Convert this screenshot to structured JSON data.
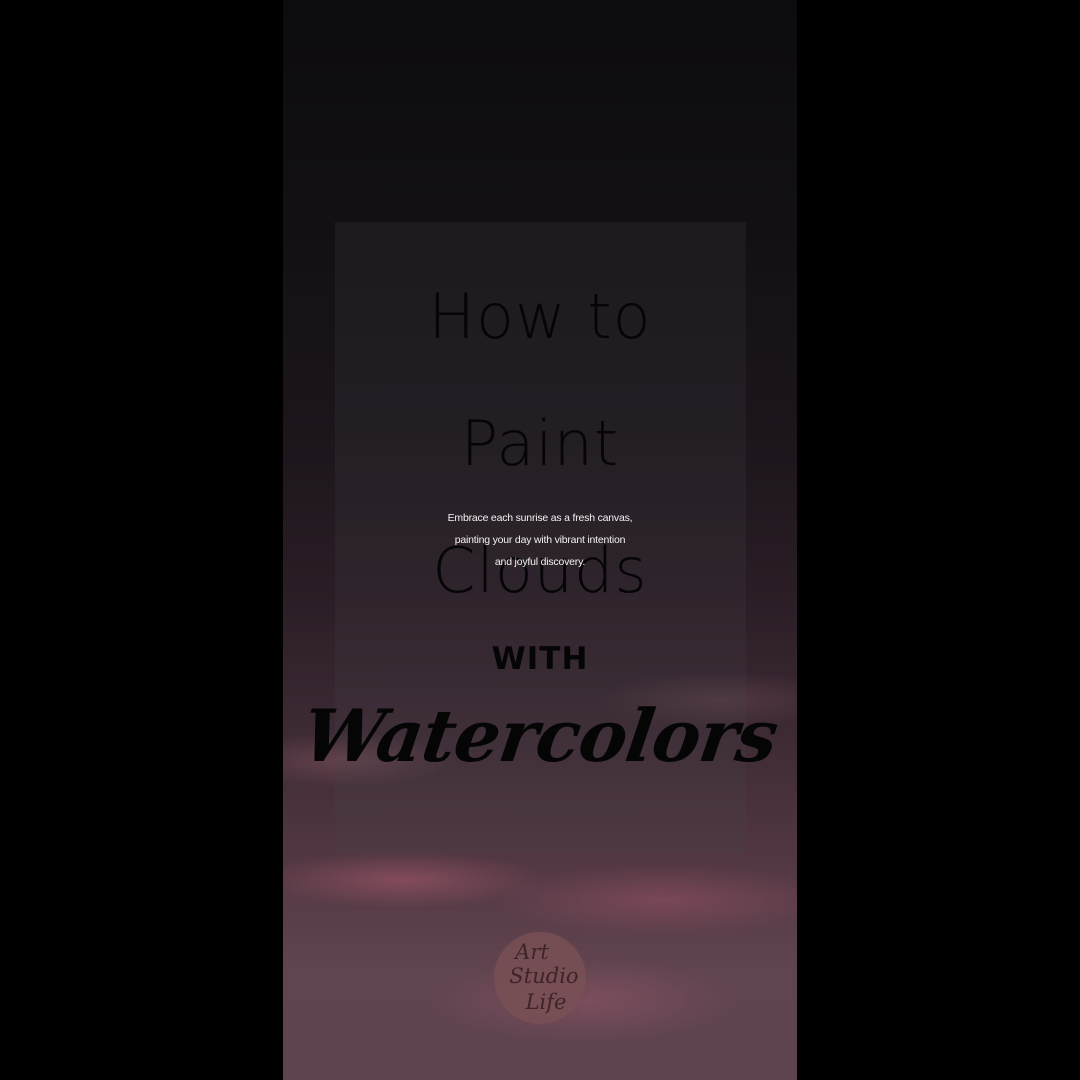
{
  "title": {
    "line1": "How to",
    "line2": "Paint",
    "line3": "Clouds"
  },
  "tagline": {
    "line1": "Embrace each sunrise as a fresh canvas,",
    "line2": "painting your day with vibrant intention",
    "line3": "and joyful discovery."
  },
  "with_text": "WITH",
  "script_text": "Watercolors",
  "logo": {
    "line1": "Art",
    "line2": "Studio",
    "line3": "Life"
  },
  "colors": {
    "background": "#000000",
    "title_text": "#050505",
    "tagline_text": "#f2f2f2",
    "logo_circle": "#785055"
  }
}
